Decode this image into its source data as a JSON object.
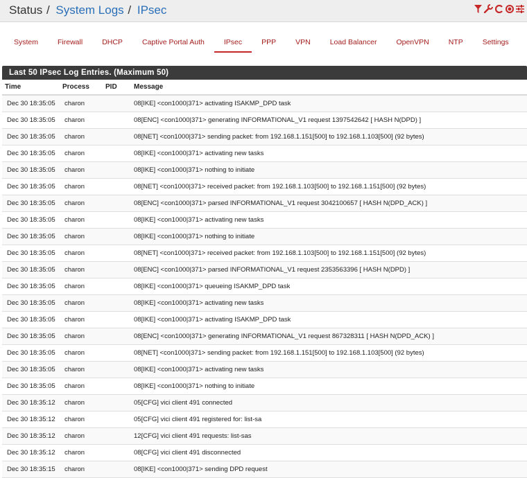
{
  "breadcrumb": {
    "root": "Status",
    "sep1": "/",
    "section": "System Logs",
    "sep2": "/",
    "page": "IPsec"
  },
  "toolbar_icons": [
    {
      "name": "filter-icon",
      "glyph": "▼",
      "color": "#c62828"
    },
    {
      "name": "wrench-icon",
      "glyph": "✎",
      "color": "#c62828"
    },
    {
      "name": "refresh-icon",
      "glyph": "C",
      "color": "#c62828"
    },
    {
      "name": "stop-icon",
      "glyph": "◉",
      "color": "#c62828"
    },
    {
      "name": "sliders-icon",
      "glyph": "☰",
      "color": "#c62828"
    }
  ],
  "tabs": [
    {
      "label": "System",
      "active": false
    },
    {
      "label": "Firewall",
      "active": false
    },
    {
      "label": "DHCP",
      "active": false
    },
    {
      "label": "Captive Portal Auth",
      "active": false
    },
    {
      "label": "IPsec",
      "active": true
    },
    {
      "label": "PPP",
      "active": false
    },
    {
      "label": "VPN",
      "active": false
    },
    {
      "label": "Load Balancer",
      "active": false
    },
    {
      "label": "OpenVPN",
      "active": false
    },
    {
      "label": "NTP",
      "active": false
    },
    {
      "label": "Settings",
      "active": false
    }
  ],
  "panel": {
    "title": "Last 50 IPsec Log Entries. (Maximum 50)",
    "columns": {
      "time": "Time",
      "process": "Process",
      "pid": "PID",
      "message": "Message"
    },
    "rows": [
      {
        "time": "Dec 30 18:35:05",
        "process": "charon",
        "pid": "",
        "message": "08[IKE] <con1000|371> activating ISAKMP_DPD task"
      },
      {
        "time": "Dec 30 18:35:05",
        "process": "charon",
        "pid": "",
        "message": "08[ENC] <con1000|371> generating INFORMATIONAL_V1 request 1397542642 [ HASH N(DPD) ]"
      },
      {
        "time": "Dec 30 18:35:05",
        "process": "charon",
        "pid": "",
        "message": "08[NET] <con1000|371> sending packet: from 192.168.1.151[500] to 192.168.1.103[500] (92 bytes)"
      },
      {
        "time": "Dec 30 18:35:05",
        "process": "charon",
        "pid": "",
        "message": "08[IKE] <con1000|371> activating new tasks"
      },
      {
        "time": "Dec 30 18:35:05",
        "process": "charon",
        "pid": "",
        "message": "08[IKE] <con1000|371> nothing to initiate"
      },
      {
        "time": "Dec 30 18:35:05",
        "process": "charon",
        "pid": "",
        "message": "08[NET] <con1000|371> received packet: from 192.168.1.103[500] to 192.168.1.151[500] (92 bytes)"
      },
      {
        "time": "Dec 30 18:35:05",
        "process": "charon",
        "pid": "",
        "message": "08[ENC] <con1000|371> parsed INFORMATIONAL_V1 request 3042100657 [ HASH N(DPD_ACK) ]"
      },
      {
        "time": "Dec 30 18:35:05",
        "process": "charon",
        "pid": "",
        "message": "08[IKE] <con1000|371> activating new tasks"
      },
      {
        "time": "Dec 30 18:35:05",
        "process": "charon",
        "pid": "",
        "message": "08[IKE] <con1000|371> nothing to initiate"
      },
      {
        "time": "Dec 30 18:35:05",
        "process": "charon",
        "pid": "",
        "message": "08[NET] <con1000|371> received packet: from 192.168.1.103[500] to 192.168.1.151[500] (92 bytes)"
      },
      {
        "time": "Dec 30 18:35:05",
        "process": "charon",
        "pid": "",
        "message": "08[ENC] <con1000|371> parsed INFORMATIONAL_V1 request 2353563396 [ HASH N(DPD) ]"
      },
      {
        "time": "Dec 30 18:35:05",
        "process": "charon",
        "pid": "",
        "message": "08[IKE] <con1000|371> queueing ISAKMP_DPD task"
      },
      {
        "time": "Dec 30 18:35:05",
        "process": "charon",
        "pid": "",
        "message": "08[IKE] <con1000|371> activating new tasks"
      },
      {
        "time": "Dec 30 18:35:05",
        "process": "charon",
        "pid": "",
        "message": "08[IKE] <con1000|371> activating ISAKMP_DPD task"
      },
      {
        "time": "Dec 30 18:35:05",
        "process": "charon",
        "pid": "",
        "message": "08[ENC] <con1000|371> generating INFORMATIONAL_V1 request 867328311 [ HASH N(DPD_ACK) ]"
      },
      {
        "time": "Dec 30 18:35:05",
        "process": "charon",
        "pid": "",
        "message": "08[NET] <con1000|371> sending packet: from 192.168.1.151[500] to 192.168.1.103[500] (92 bytes)"
      },
      {
        "time": "Dec 30 18:35:05",
        "process": "charon",
        "pid": "",
        "message": "08[IKE] <con1000|371> activating new tasks"
      },
      {
        "time": "Dec 30 18:35:05",
        "process": "charon",
        "pid": "",
        "message": "08[IKE] <con1000|371> nothing to initiate"
      },
      {
        "time": "Dec 30 18:35:12",
        "process": "charon",
        "pid": "",
        "message": "05[CFG] vici client 491 connected"
      },
      {
        "time": "Dec 30 18:35:12",
        "process": "charon",
        "pid": "",
        "message": "05[CFG] vici client 491 registered for: list-sa"
      },
      {
        "time": "Dec 30 18:35:12",
        "process": "charon",
        "pid": "",
        "message": "12[CFG] vici client 491 requests: list-sas"
      },
      {
        "time": "Dec 30 18:35:12",
        "process": "charon",
        "pid": "",
        "message": "08[CFG] vici client 491 disconnected"
      },
      {
        "time": "Dec 30 18:35:15",
        "process": "charon",
        "pid": "",
        "message": "08[IKE] <con1000|371> sending DPD request"
      }
    ]
  }
}
